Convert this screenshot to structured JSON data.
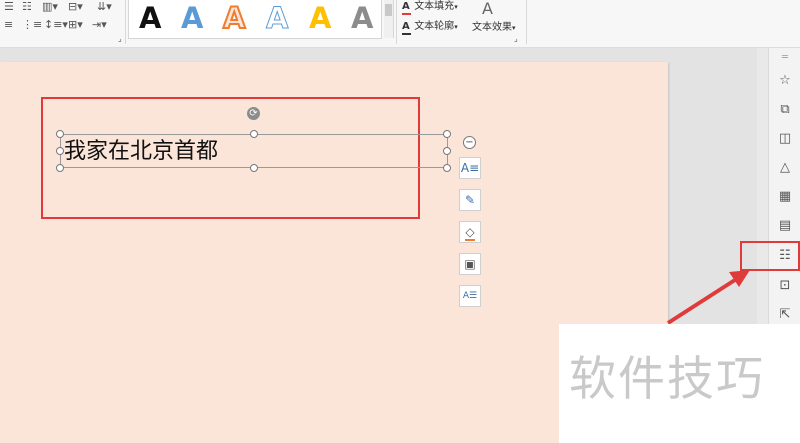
{
  "ribbon": {
    "wordart_styles": [
      {
        "glyph": "A",
        "color": "#111111",
        "style": "solid"
      },
      {
        "glyph": "A",
        "color": "#5b9bd5",
        "style": "solid"
      },
      {
        "glyph": "A",
        "color": "#ed7d31",
        "style": "outline"
      },
      {
        "glyph": "A",
        "color": "#5b9bd5",
        "style": "outline-light"
      },
      {
        "glyph": "A",
        "color": "#ffc000",
        "style": "solid"
      },
      {
        "glyph": "A",
        "color": "#8c8c8c",
        "style": "gradient"
      }
    ],
    "text_fill_label": "文本填充",
    "text_outline_label": "文本轮廓",
    "text_effect_label": "文本效果",
    "text_effect_icon": "A"
  },
  "slide": {
    "textbox_text": "我家在北京首都"
  },
  "float_toolbar": {
    "minus_icon": "−"
  },
  "watermark": {
    "text": "软件技巧"
  },
  "colors": {
    "highlight_red": "#e03b3b",
    "slide_bg": "#fbe5d9"
  }
}
